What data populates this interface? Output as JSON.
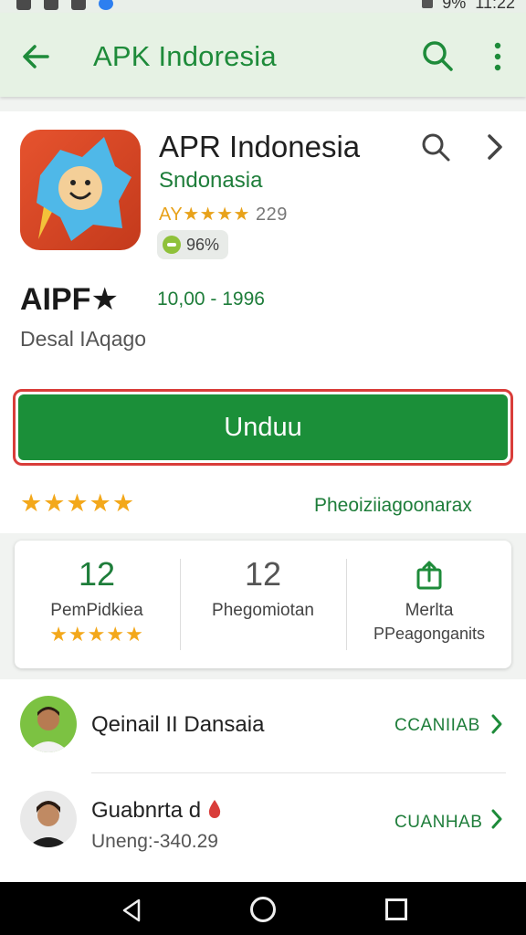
{
  "status_bar": {
    "battery": "9%",
    "time": "11:22"
  },
  "app_bar": {
    "title": "APK Indoresia",
    "back_icon": "arrow-left-icon",
    "search_icon": "search-icon",
    "more_icon": "more-vert-icon"
  },
  "app": {
    "name": "APR Indonesia",
    "developer": "Sndonasia",
    "rating_prefix": "AY",
    "rating_stars": "★★★★",
    "rating_count": "229",
    "badge": "96%",
    "big_label": "AIPF★",
    "sub_label": "Desal IAqago",
    "range": "10,00 - 1996"
  },
  "install": {
    "label": "Unduu"
  },
  "rating_row": {
    "stars": "★★★★★",
    "link": "Pheoiziiagoonarax"
  },
  "stats": [
    {
      "value": "12",
      "label": "PemPidkiea",
      "stars": "★★★★★"
    },
    {
      "value": "12",
      "label": "Phegomiotan"
    },
    {
      "icon": "share-icon",
      "label": "Merlta",
      "label2": "PPeagonganits"
    }
  ],
  "list": [
    {
      "name": "Qeinail II Dansaia",
      "action": "CCANIIAB"
    },
    {
      "name": "Guabnrta d",
      "sub": "Uneng:-340.29",
      "action": "CUANHAB"
    }
  ],
  "colors": {
    "accent": "#1e8b3a",
    "install": "#1b8f39",
    "star": "#f3a81b",
    "highlight_border": "#d93d3a"
  }
}
